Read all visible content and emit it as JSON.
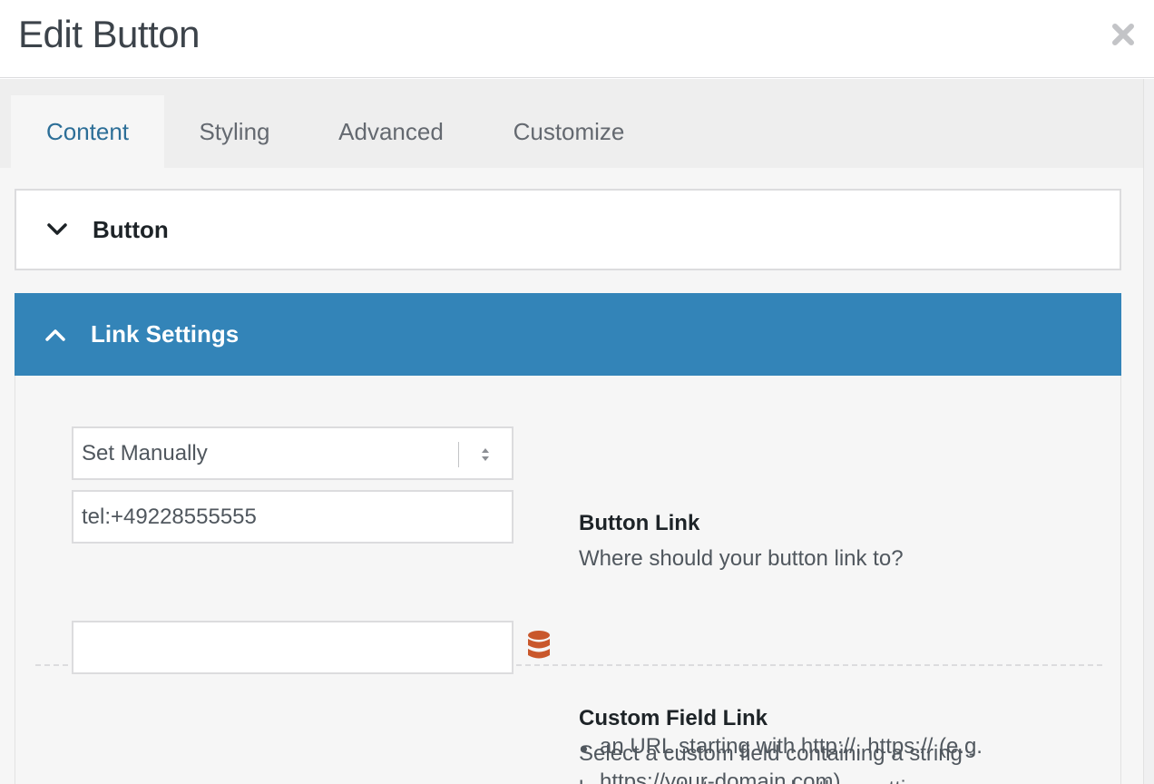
{
  "dialog": {
    "title": "Edit Button",
    "close_icon": "close-icon"
  },
  "tabs": [
    {
      "label": "Content",
      "active": true
    },
    {
      "label": "Styling",
      "active": false
    },
    {
      "label": "Advanced",
      "active": false
    },
    {
      "label": "Customize",
      "active": false
    }
  ],
  "sections": {
    "button": {
      "label": "Button",
      "icon": "chevron-down-icon",
      "expanded": false
    },
    "link_settings": {
      "label": "Link Settings",
      "icon": "chevron-up-icon",
      "expanded": true
    }
  },
  "button_link": {
    "select_value": "Set Manually",
    "url_value": "tel:+49228555555",
    "title": "Button Link",
    "description": "Where should your button link to?"
  },
  "custom_field_link": {
    "value": "",
    "icon": "database-icon",
    "title": "Custom Field Link",
    "description_line1": "Select a custom field containing a string -",
    "description_line2": "leave empty to use selectbox setting:",
    "bullets": [
      {
        "line1": "an URL starting with http://, https:// (e.g.",
        "line2": "https://your-domain.com)"
      }
    ]
  },
  "colors": {
    "accent": "#3384b8",
    "active_tab_text": "#2c6e97",
    "db_icon": "#c9572b"
  }
}
